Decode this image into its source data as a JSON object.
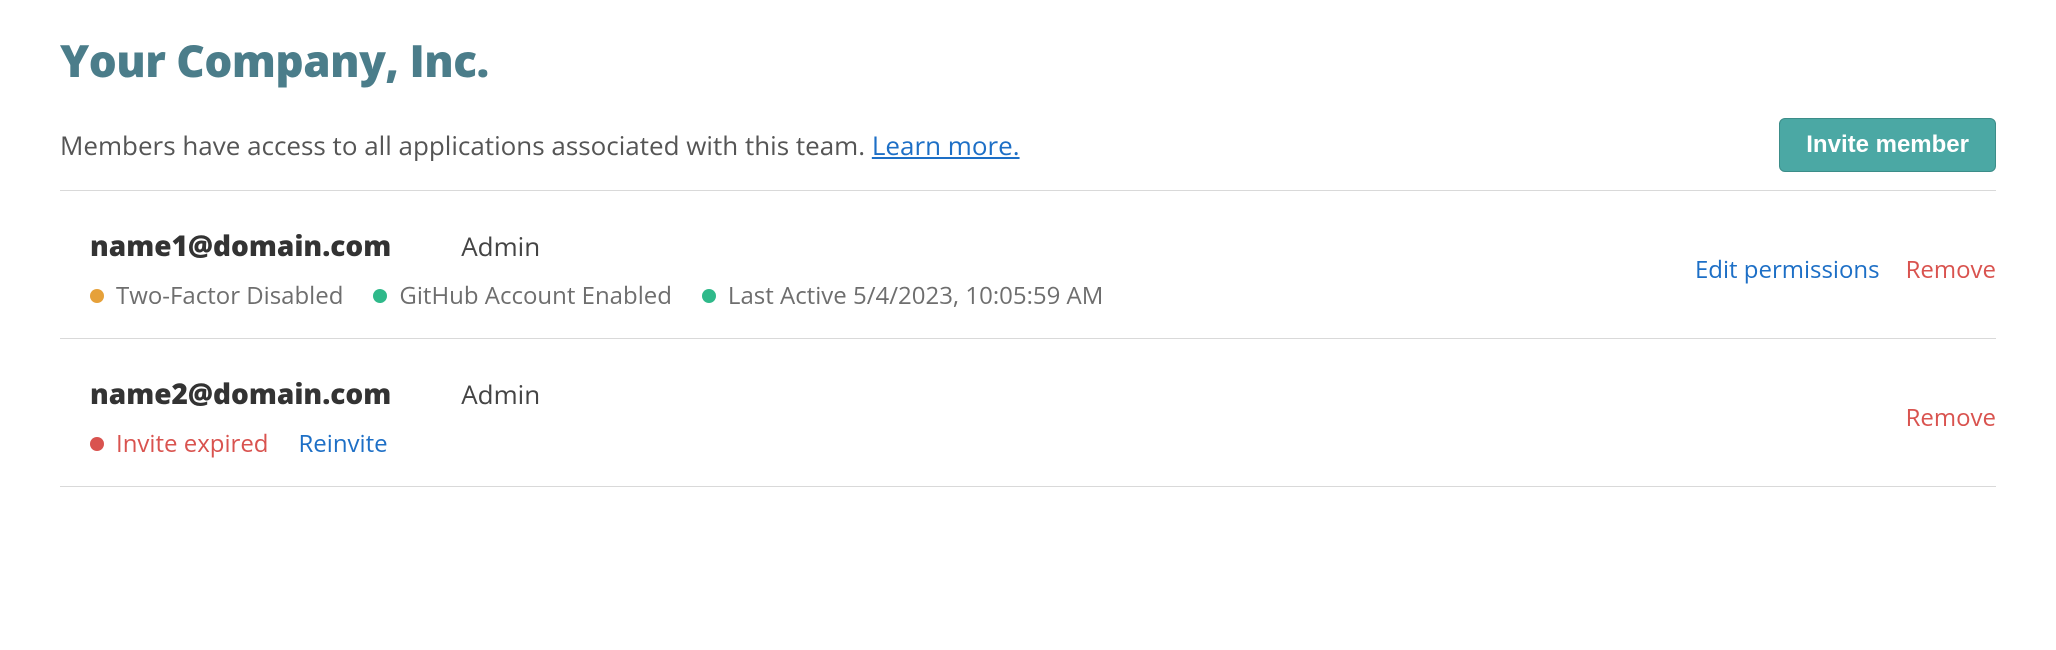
{
  "header": {
    "title": "Your Company, Inc."
  },
  "intro": {
    "text": "Members have access to all applications associated with this team. ",
    "learn_more": "Learn more.",
    "invite_button": "Invite member"
  },
  "actions": {
    "edit_permissions": "Edit permissions",
    "remove": "Remove",
    "reinvite": "Reinvite"
  },
  "members": [
    {
      "email": "name1@domain.com",
      "role": "Admin",
      "two_factor_label": "Two-Factor Disabled",
      "github_label": "GitHub Account Enabled",
      "last_active_label": "Last Active 5/4/2023, 10:05:59 AM"
    },
    {
      "email": "name2@domain.com",
      "role": "Admin",
      "invite_status": "Invite expired"
    }
  ]
}
